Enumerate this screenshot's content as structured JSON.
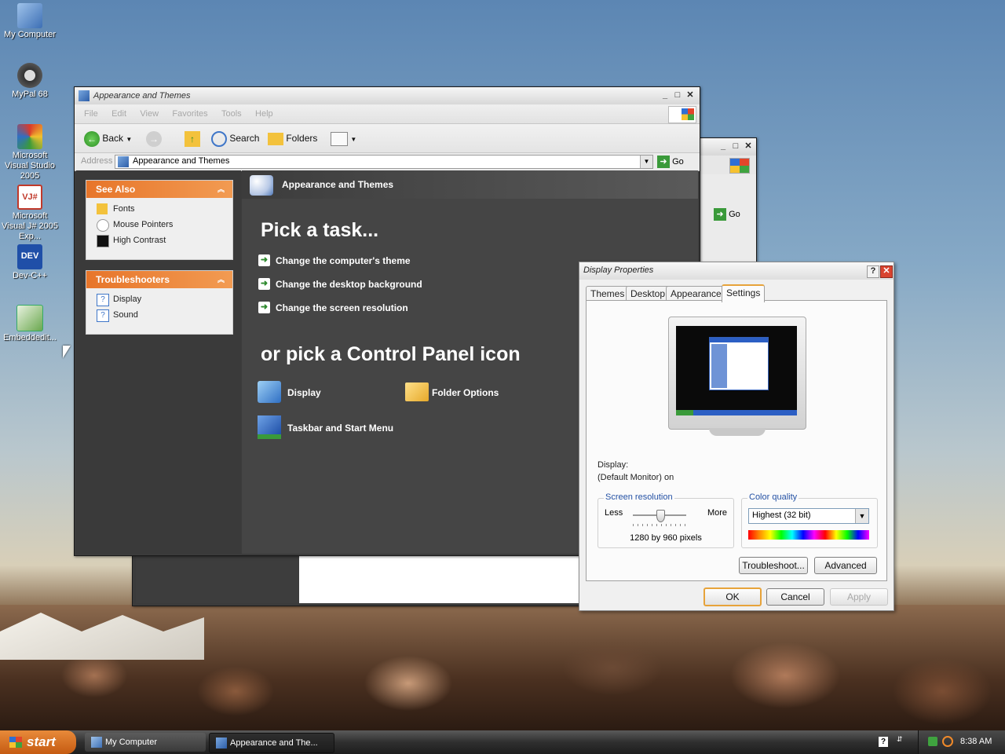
{
  "desktop": {
    "icons": [
      {
        "label": "My Computer"
      },
      {
        "label": "MyPal 68"
      },
      {
        "label": "Microsoft Visual Studio 2005"
      },
      {
        "label": "Microsoft Visual J# 2005 Exp..."
      },
      {
        "label": "Dev-C++"
      },
      {
        "label": "Embeddedit..."
      }
    ]
  },
  "explorer": {
    "title": "Appearance and Themes",
    "menu": [
      "File",
      "Edit",
      "View",
      "Favorites",
      "Tools",
      "Help"
    ],
    "toolbar": {
      "back": "Back",
      "search": "Search",
      "folders": "Folders"
    },
    "address": {
      "label": "Address",
      "value": "Appearance and Themes",
      "go": "Go"
    },
    "see_also": {
      "title": "See Also",
      "items": [
        "Fonts",
        "Mouse Pointers",
        "High Contrast"
      ]
    },
    "troubleshooters": {
      "title": "Troubleshooters",
      "items": [
        "Display",
        "Sound"
      ]
    },
    "header": "Appearance and Themes",
    "pick_task": "Pick a task...",
    "tasks": [
      "Change the computer's theme",
      "Change the desktop background",
      "Change the screen resolution"
    ],
    "pick_icon": "or pick a Control Panel icon",
    "icons": [
      "Display",
      "Folder Options",
      "Taskbar and Start Menu"
    ]
  },
  "back_window": {
    "go": "Go"
  },
  "display_properties": {
    "title": "Display Properties",
    "tabs": [
      "Themes",
      "Desktop",
      "Appearance",
      "Settings"
    ],
    "active_tab": "Settings",
    "display_label": "Display:",
    "display_value": "(Default Monitor) on",
    "resolution": {
      "label": "Screen resolution",
      "less": "Less",
      "more": "More",
      "value": "1280 by 960 pixels",
      "slider_position": 0.5
    },
    "color_quality": {
      "label": "Color quality",
      "value": "Highest (32 bit)"
    },
    "buttons": {
      "troubleshoot": "Troubleshoot...",
      "advanced": "Advanced",
      "ok": "OK",
      "cancel": "Cancel",
      "apply": "Apply"
    }
  },
  "taskbar": {
    "start": "start",
    "buttons": [
      "My Computer",
      "Appearance and The..."
    ],
    "clock": "8:38 AM"
  },
  "colors": {
    "accent_orange": "#e7752a",
    "dark_panel": "#3a3a3a",
    "task_green": "#2f8a2f"
  }
}
